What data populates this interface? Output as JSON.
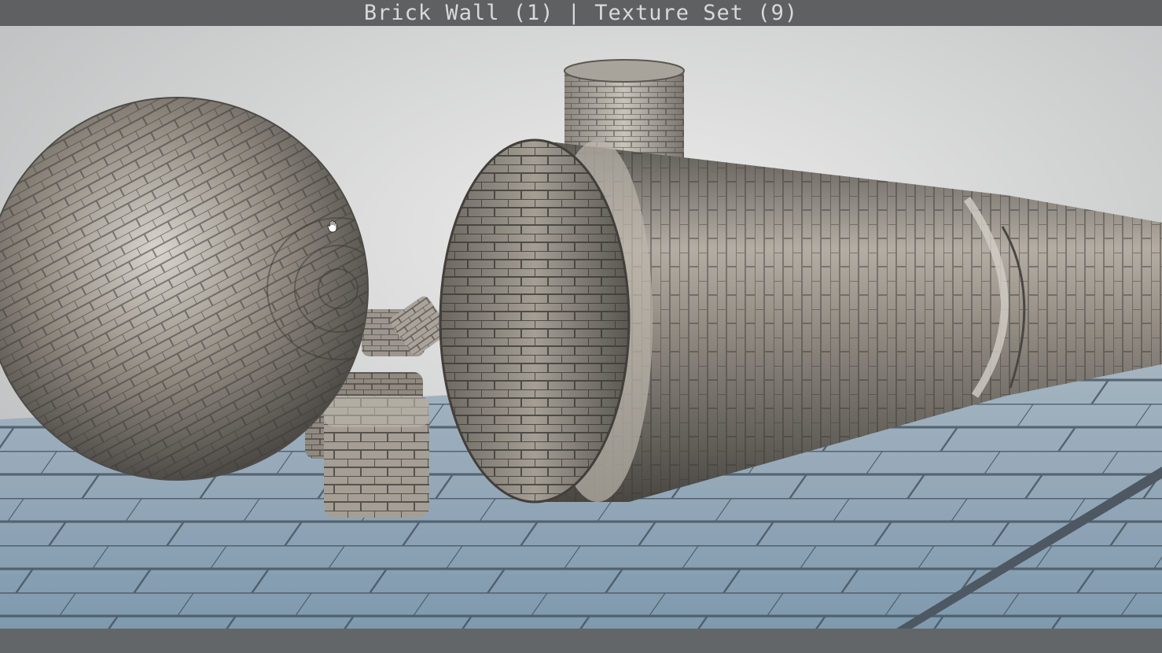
{
  "header": {
    "title": "Brick Wall (1) | Texture Set (9)"
  },
  "viewport": {
    "objects": [
      "sphere",
      "cube",
      "cube",
      "cube",
      "capsule",
      "cylinder",
      "floor-plane"
    ],
    "material": "brick-tiles-metallic"
  },
  "colors": {
    "title_bar": "#5f6061",
    "title_text": "#d9d9d9",
    "background": "#cfd0d0",
    "floor": "#8fa6b8",
    "metal": "#9a948c"
  },
  "icons": [
    "hand-cursor-icon"
  ]
}
